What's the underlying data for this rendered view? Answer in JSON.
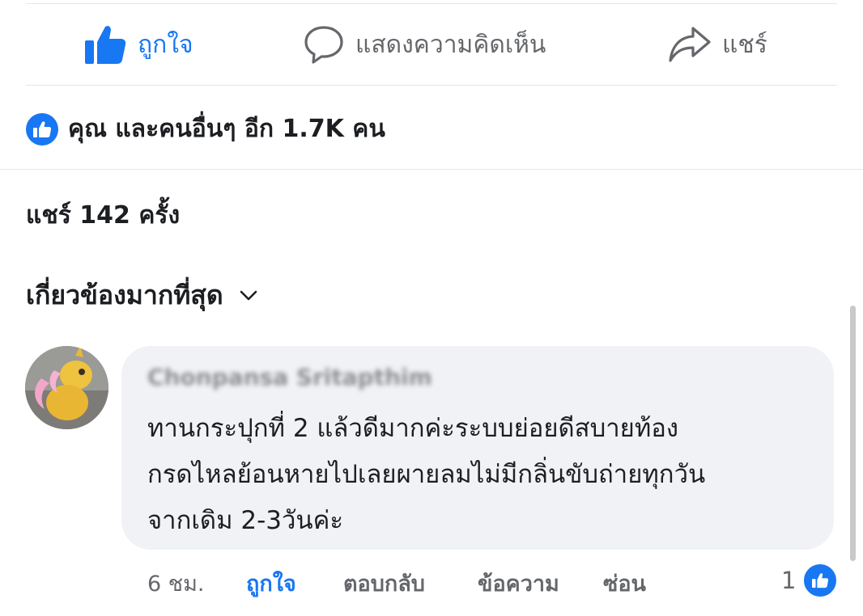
{
  "actions": {
    "like_label": "ถูกใจ",
    "comment_label": "แสดงความคิดเห็น",
    "share_label": "แชร์"
  },
  "reactions": {
    "summary": "คุณ และคนอื่นๆ อีก 1.7K คน"
  },
  "shares": {
    "summary": "แชร์ 142 ครั้ง"
  },
  "sort": {
    "label": "เกี่ยวข้องมากที่สุด"
  },
  "comment": {
    "author": "Chonpansa Sritapthim",
    "lines": [
      "ทานกระปุกที่ 2 แล้วดีมากค่ะระบบย่อยดีสบายท้อง",
      "กรดไหลย้อนหายไปเลยผายลมไม่มีกลิ่นขับถ่ายทุกวัน",
      "จากเดิม 2-3วันค่ะ"
    ],
    "time": "6 ชม.",
    "like_label": "ถูกใจ",
    "reply_label": "ตอบกลับ",
    "message_label": "ข้อความ",
    "hide_label": "ซ่อน",
    "reaction_count": "1"
  },
  "colors": {
    "accent": "#1877f2",
    "muted": "#65676b",
    "bubble": "#f0f2f5"
  }
}
